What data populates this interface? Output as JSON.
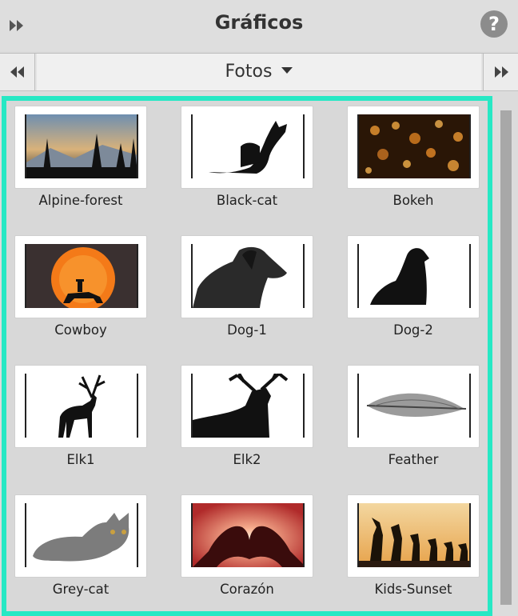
{
  "header": {
    "title": "Gráficos",
    "help_glyph": "?"
  },
  "nav": {
    "selected": "Fotos"
  },
  "items": [
    {
      "label": "Alpine-forest"
    },
    {
      "label": "Black-cat"
    },
    {
      "label": "Bokeh"
    },
    {
      "label": "Cowboy"
    },
    {
      "label": "Dog-1"
    },
    {
      "label": "Dog-2"
    },
    {
      "label": "Elk1"
    },
    {
      "label": "Elk2"
    },
    {
      "label": "Feather"
    },
    {
      "label": "Grey-cat"
    },
    {
      "label": "Corazón"
    },
    {
      "label": "Kids-Sunset"
    }
  ],
  "colors": {
    "accent": "#27e8c4",
    "panel": "#d8d8d8"
  }
}
